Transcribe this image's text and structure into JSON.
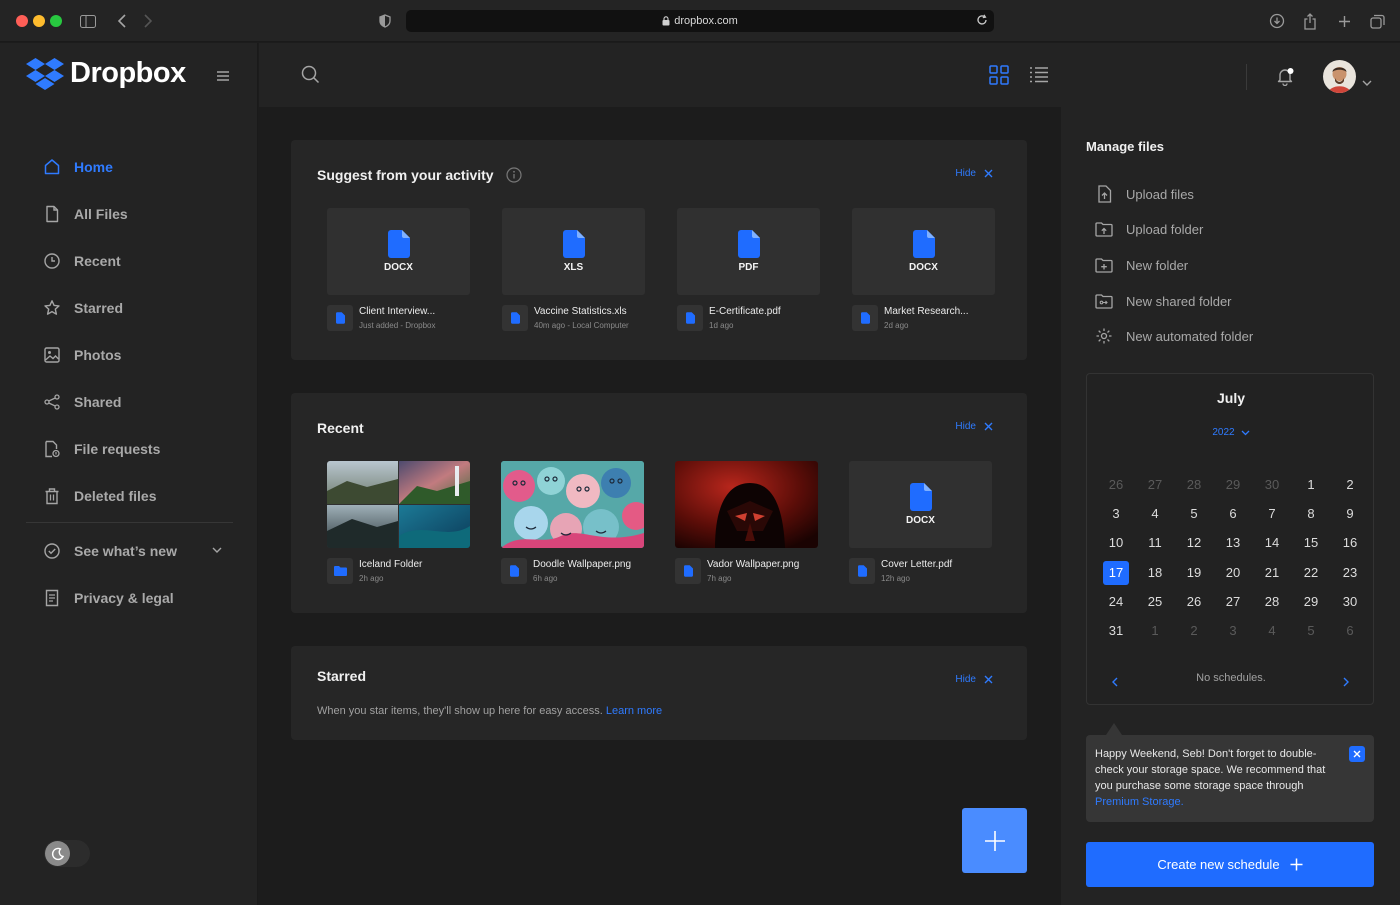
{
  "browser": {
    "url": "dropbox.com"
  },
  "brand": {
    "name": "Dropbox",
    "accent": "#1f6cff"
  },
  "sidebar": {
    "items": [
      {
        "label": "Home",
        "icon": "home-icon"
      },
      {
        "label": "All Files",
        "icon": "file-icon"
      },
      {
        "label": "Recent",
        "icon": "clock-icon"
      },
      {
        "label": "Starred",
        "icon": "star-icon"
      },
      {
        "label": "Photos",
        "icon": "image-icon"
      },
      {
        "label": "Shared",
        "icon": "share-icon"
      },
      {
        "label": "File requests",
        "icon": "file-request-icon"
      },
      {
        "label": "Deleted files",
        "icon": "trash-icon"
      }
    ],
    "whats_new": "See what’s new",
    "privacy": "Privacy & legal"
  },
  "suggest": {
    "title": "Suggest from your activity",
    "hide": "Hide",
    "files": [
      {
        "ext": "DOCX",
        "name": "Client Interview...",
        "sub": "Just added - Dropbox"
      },
      {
        "ext": "XLS",
        "name": "Vaccine Statistics.xls",
        "sub": "40m ago - Local Computer"
      },
      {
        "ext": "PDF",
        "name": "E-Certificate.pdf",
        "sub": "1d ago"
      },
      {
        "ext": "DOCX",
        "name": "Market Research...",
        "sub": "2d ago"
      }
    ]
  },
  "recent": {
    "title": "Recent",
    "hide": "Hide",
    "files": [
      {
        "name": "Iceland Folder",
        "sub": "2h ago"
      },
      {
        "name": "Doodle Wallpaper.png",
        "sub": "6h ago"
      },
      {
        "name": "Vador Wallpaper.png",
        "sub": "7h ago"
      },
      {
        "ext": "DOCX",
        "name": "Cover Letter.pdf",
        "sub": "12h ago"
      }
    ]
  },
  "starred": {
    "title": "Starred",
    "hide": "Hide",
    "text": "When you star items, they'll show up here for easy access.",
    "link": "Learn more"
  },
  "manage": {
    "title": "Manage files",
    "items": [
      {
        "label": "Upload files",
        "icon": "upload-file-icon"
      },
      {
        "label": "Upload folder",
        "icon": "upload-folder-icon"
      },
      {
        "label": "New folder",
        "icon": "new-folder-icon"
      },
      {
        "label": "New shared folder",
        "icon": "shared-folder-icon"
      },
      {
        "label": "New automated folder",
        "icon": "automated-folder-icon"
      }
    ]
  },
  "calendar": {
    "month": "July",
    "year": "2022",
    "selected": "17",
    "weeks": [
      [
        "26",
        "27",
        "28",
        "29",
        "30",
        "1",
        "2"
      ],
      [
        "3",
        "4",
        "5",
        "6",
        "7",
        "8",
        "9"
      ],
      [
        "10",
        "11",
        "12",
        "13",
        "14",
        "15",
        "16"
      ],
      [
        "17",
        "18",
        "19",
        "20",
        "21",
        "22",
        "23"
      ],
      [
        "24",
        "25",
        "26",
        "27",
        "28",
        "29",
        "30"
      ],
      [
        "31",
        "1",
        "2",
        "3",
        "4",
        "5",
        "6"
      ]
    ],
    "empty": "No schedules."
  },
  "tip": {
    "text": "Happy Weekend, Seb! Don't forget to double-check your storage space. We recommend that you purchase some storage space through ",
    "link": "Premium Storage."
  },
  "create_button": "Create new schedule"
}
